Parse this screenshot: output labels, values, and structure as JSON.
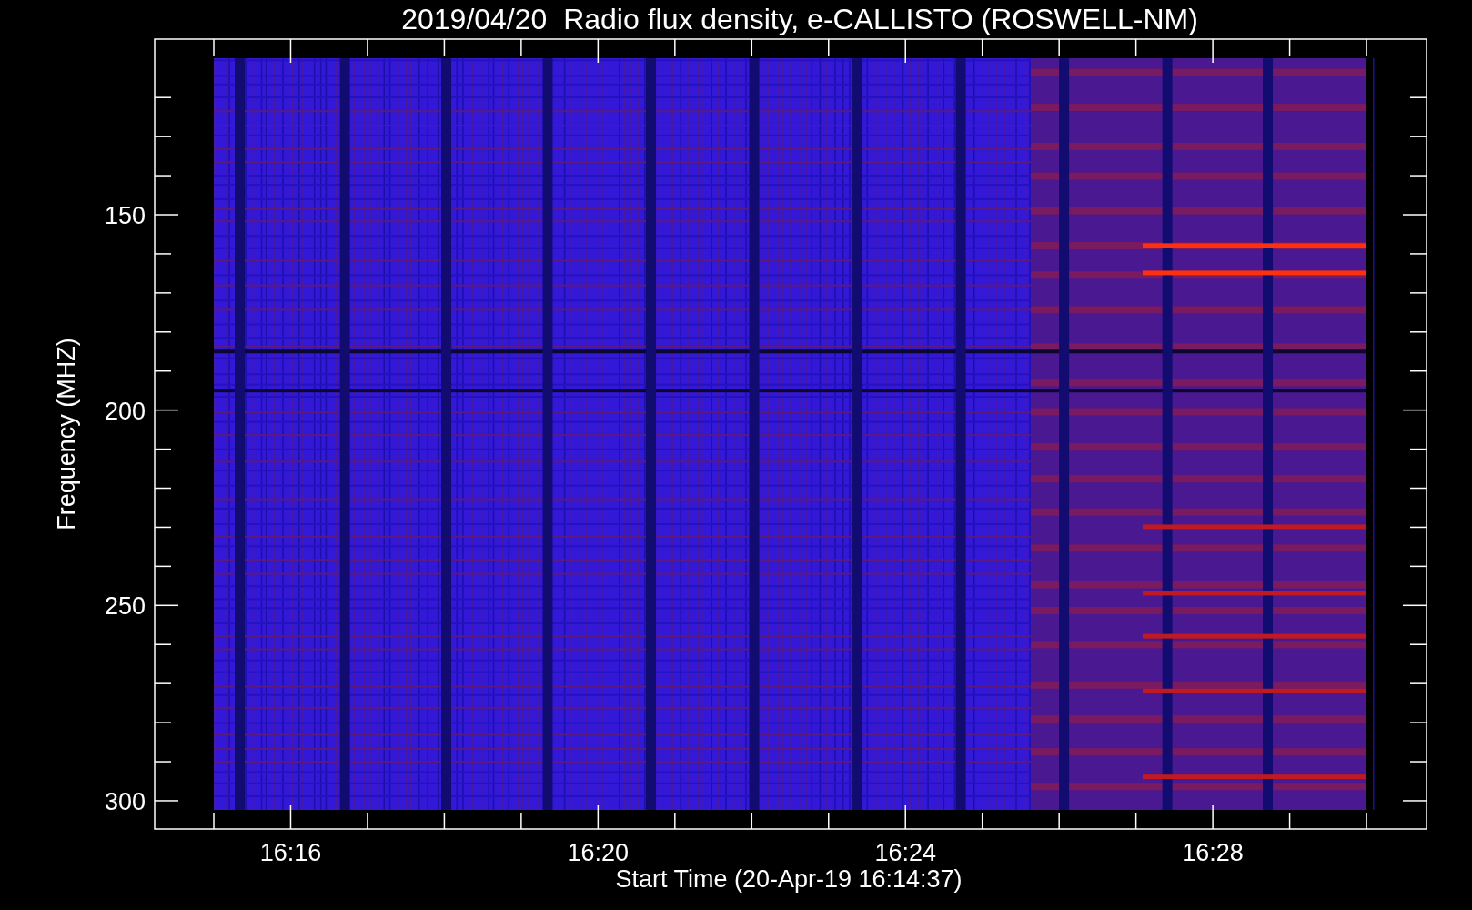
{
  "title": "2019/04/20  Radio flux density, e-CALLISTO (ROSWELL-NM)",
  "y_axis": {
    "label": "Frequency (MHZ)",
    "ticks": [
      "150",
      "200",
      "250",
      "300"
    ]
  },
  "x_axis": {
    "label": "Start Time (20-Apr-19 16:14:37)",
    "ticks": [
      "16:16",
      "16:20",
      "16:24",
      "16:28"
    ]
  }
}
